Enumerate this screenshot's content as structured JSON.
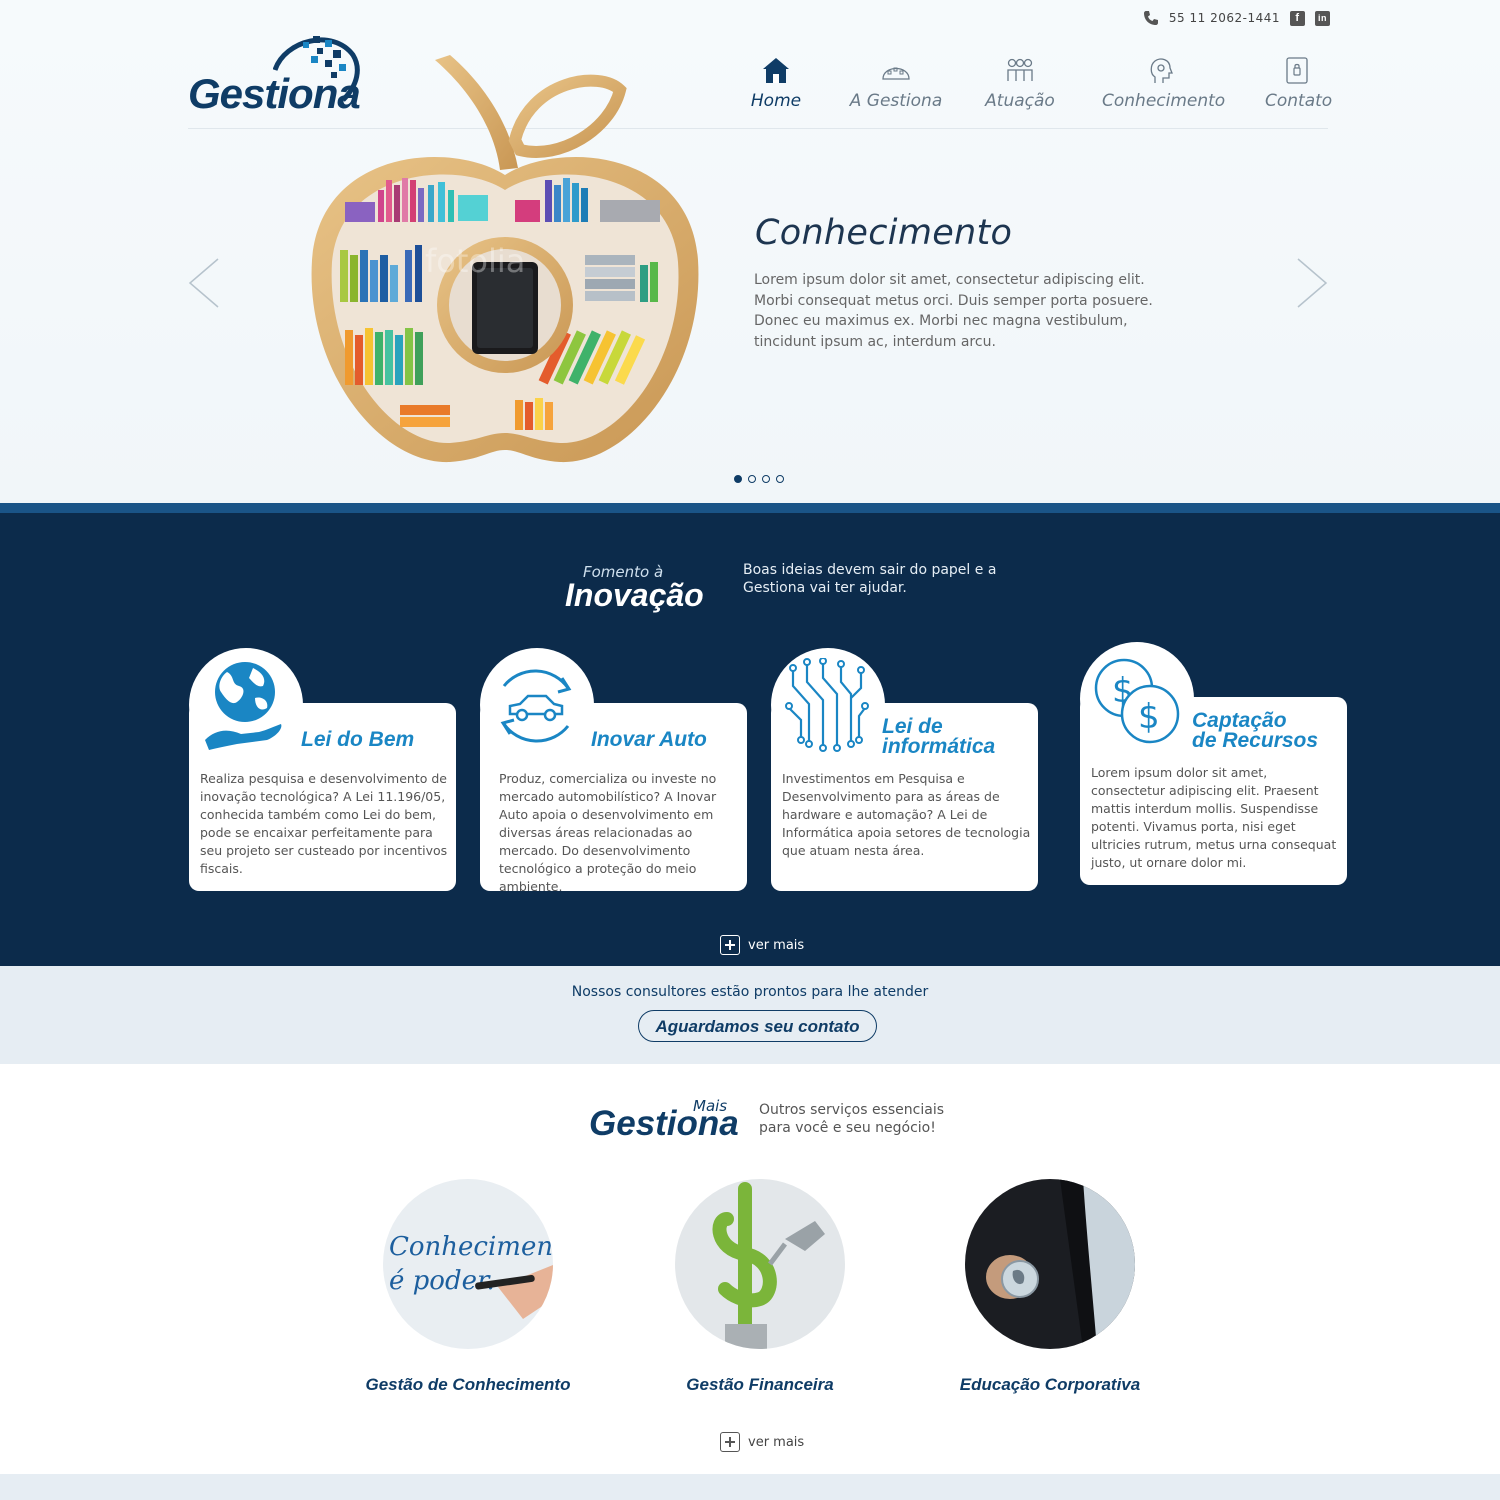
{
  "topbar": {
    "phone": "55 11 2062-1441",
    "social": [
      "f",
      "in"
    ]
  },
  "logo": {
    "text": "Gestiona"
  },
  "nav": [
    {
      "label": "Home",
      "icon": "home-icon",
      "active": true
    },
    {
      "label": "A Gestiona",
      "icon": "building-icon",
      "active": false
    },
    {
      "label": "Atuação",
      "icon": "people-icon",
      "active": false
    },
    {
      "label": "Conhecimento",
      "icon": "head-icon",
      "active": false
    },
    {
      "label": "Contato",
      "icon": "phone-book-icon",
      "active": false
    }
  ],
  "slider": {
    "title": "Conhecimento",
    "text": "Lorem ipsum dolor sit amet, consectetur adipiscing elit. Morbi consequat metus orci. Duis semper porta posuere. Donec eu maximus ex. Morbi nec magna vestibulum, tincidunt ipsum ac, interdum arcu.",
    "watermark": "fotolia",
    "slides": 4,
    "active_slide": 1
  },
  "innovation": {
    "small": "Fomento à",
    "big": "Inovação",
    "tagline": "Boas ideias devem sair do papel e a Gestiona vai ter ajudar.",
    "cards": [
      {
        "title": "Lei do Bem",
        "icon": "globe-hand-icon",
        "text": "Realiza pesquisa e desenvolvimento de inovação tecnológica? A Lei 11.196/05, conhecida também como Lei do bem, pode se encaixar perfeitamente para seu projeto ser custeado por incentivos fiscais."
      },
      {
        "title": "Inovar Auto",
        "icon": "car-cycle-icon",
        "text": "Produz, comercializa ou investe no mercado automobilístico? A Inovar Auto apoia o desenvolvimento em diversas áreas relacionadas ao mercado. Do desenvolvimento tecnológico a proteção do meio ambiente."
      },
      {
        "title_line1": "Lei de",
        "title_line2": "informática",
        "icon": "circuit-icon",
        "text": "Investimentos em Pesquisa e Desenvolvimento para as áreas de hardware e automação? A Lei de Informática apoia setores de tecnologia que atuam nesta área."
      },
      {
        "title_line1": "Captação",
        "title_line2": "de Recursos",
        "icon": "coins-icon",
        "text": "Lorem ipsum dolor sit amet, consectetur adipiscing elit. Praesent mattis interdum mollis. Suspendisse potenti. Vivamus porta, nisi eget ultricies rutrum, metus urna consequat justo, ut ornare dolor mi."
      }
    ],
    "more": "ver mais"
  },
  "contact_band": {
    "text": "Nossos consultores estão prontos para lhe atender",
    "button": "Aguardamos seu contato"
  },
  "more_services": {
    "small": "Mais",
    "big": "Gestiona",
    "tagline": "Outros serviços essenciais para você e seu negócio!",
    "items": [
      {
        "label": "Gestão de Conhecimento",
        "image_text_1": "Conhecimento",
        "image_text_2": "é poder."
      },
      {
        "label": "Gestão Financeira"
      },
      {
        "label": "Educação Corporativa"
      }
    ],
    "more": "ver mais"
  },
  "colors": {
    "navy": "#0c2b4b",
    "brand": "#0f3c66",
    "accent": "#1a86c4"
  }
}
